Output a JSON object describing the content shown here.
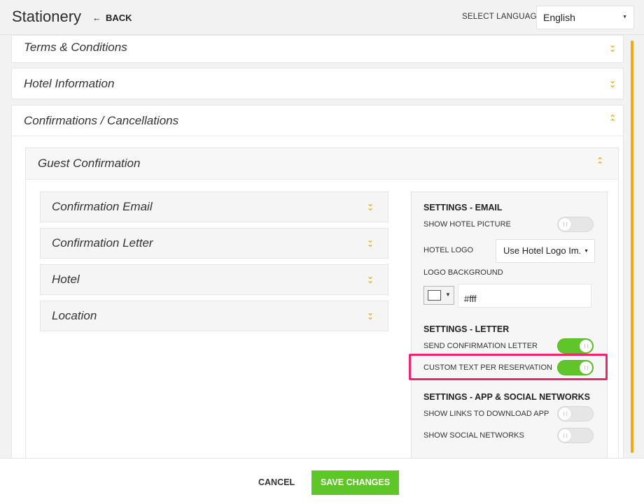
{
  "header": {
    "title": "Stationery",
    "back_label": "BACK",
    "language_label": "SELECT LANGUAGE",
    "language_value": "English"
  },
  "sections": {
    "terms": "Terms & Conditions",
    "hotel_info": "Hotel Information",
    "confirmations": "Confirmations / Cancellations"
  },
  "guest_confirmation": {
    "title": "Guest Confirmation",
    "items": [
      {
        "label": "Confirmation Email"
      },
      {
        "label": "Confirmation Letter"
      },
      {
        "label": "Hotel"
      },
      {
        "label": "Location"
      }
    ]
  },
  "settings": {
    "email_title": "SETTINGS - EMAIL",
    "show_hotel_picture": {
      "label": "SHOW HOTEL PICTURE",
      "on": false
    },
    "hotel_logo": {
      "label": "HOTEL LOGO",
      "value": "Use Hotel Logo Im."
    },
    "logo_background": {
      "label": "LOGO BACKGROUND",
      "value": "#fff"
    },
    "letter_title": "SETTINGS - LETTER",
    "send_confirmation_letter": {
      "label": "SEND CONFIRMATION LETTER",
      "on": true
    },
    "custom_text_per_reservation": {
      "label": "CUSTOM TEXT PER RESERVATION",
      "on": true
    },
    "app_title": "SETTINGS - APP & SOCIAL NETWORKS",
    "show_links_download_app": {
      "label": "SHOW LINKS TO DOWNLOAD APP",
      "on": false
    },
    "show_social_networks": {
      "label": "SHOW SOCIAL NETWORKS",
      "on": false
    }
  },
  "footer": {
    "cancel_label": "CANCEL",
    "save_label": "SAVE CHANGES"
  },
  "colors": {
    "accent": "#f2a914",
    "toggle_on": "#5fc629",
    "highlight": "#f0246d"
  }
}
